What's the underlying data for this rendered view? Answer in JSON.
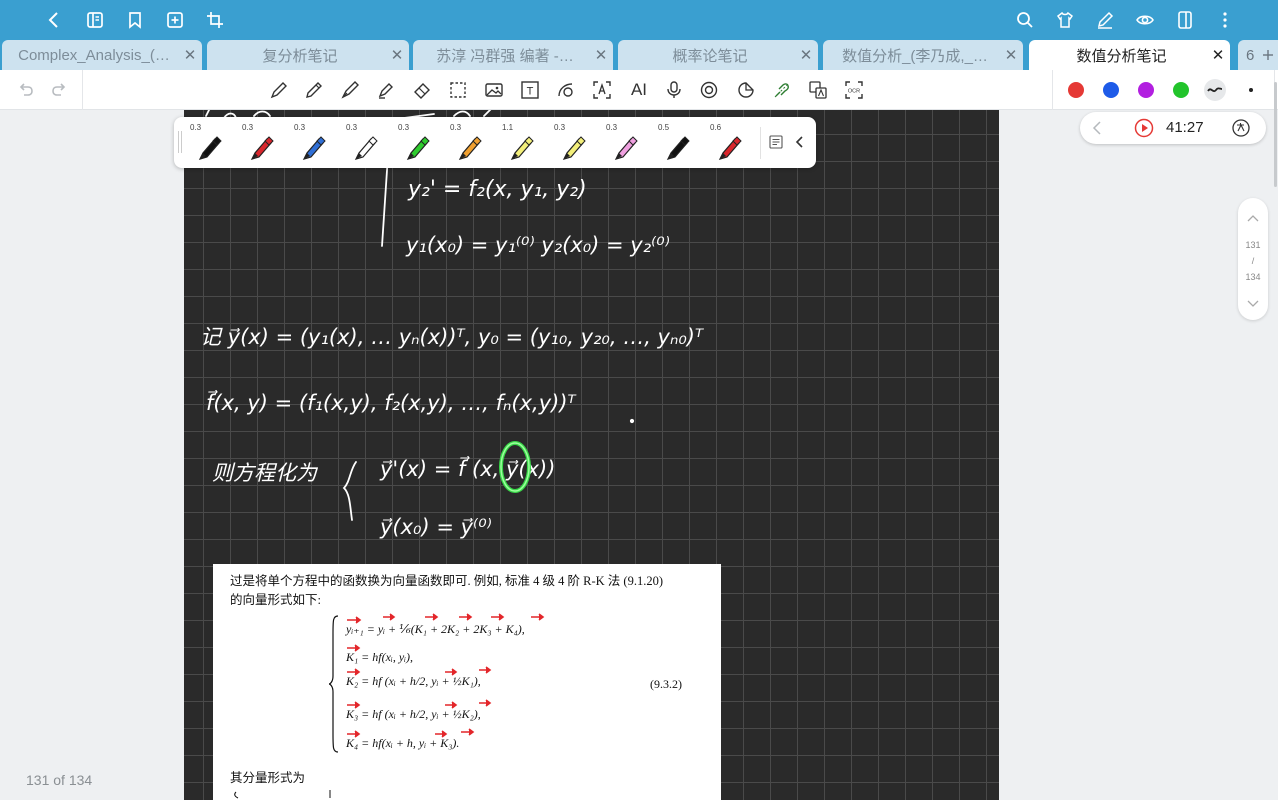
{
  "tabs": [
    {
      "label": "Complex_Analysis_(…",
      "close": "✕"
    },
    {
      "label": "复分析笔记",
      "close": "✕"
    },
    {
      "label": "苏淳 冯群强 编著 -…",
      "close": "✕"
    },
    {
      "label": "概率论笔记",
      "close": "✕"
    },
    {
      "label": "数值分析_(李乃成,_…",
      "close": "✕"
    },
    {
      "label": "数值分析笔记",
      "close": "✕",
      "active": true
    }
  ],
  "tab_more": {
    "count": "6",
    "icon": "plus-icon"
  },
  "toolbar": {
    "text_tool_label": "T",
    "ai_label": "AI",
    "ocr_label": "OCR",
    "colors": [
      "#e53935",
      "#1e5be8",
      "#b21fe0",
      "#22c42b"
    ]
  },
  "pens": [
    {
      "size": "0.3",
      "color": "#111111"
    },
    {
      "size": "0.3",
      "color": "#d9262c"
    },
    {
      "size": "0.3",
      "color": "#2f6fd6"
    },
    {
      "size": "0.3",
      "color": "#ffffff"
    },
    {
      "size": "0.3",
      "color": "#2ecc2e"
    },
    {
      "size": "0.3",
      "color": "#f0a030"
    },
    {
      "size": "1.1",
      "color": "#f3ef7a"
    },
    {
      "size": "0.3",
      "color": "#f3ef7a"
    },
    {
      "size": "0.3",
      "color": "#f0a0e0"
    },
    {
      "size": "0.5",
      "color": "#111111"
    },
    {
      "size": "0.6",
      "color": "#d9262c"
    }
  ],
  "recording": {
    "time": "41:27"
  },
  "page_nav": {
    "current": "131",
    "sep": "/",
    "total": "134"
  },
  "page_count": "131 of 134",
  "paper": {
    "line1": "过是将单个方程中的函数换为向量函数即可. 例如, 标准 4 级 4 阶 R-K 法 (9.1.20)",
    "line2": "的向量形式如下:",
    "eq1": "yᵢ₊₁ = yᵢ + ⅙(K₁ + 2K₂ + 2K₃ + K₄),",
    "eq2": "K₁ = hf(xᵢ, yᵢ),",
    "eq3": "K₂ = hf (xᵢ + h/2, yᵢ + ½K₁),",
    "eq4": "K₃ = hf (xᵢ + h/2, yᵢ + ½K₂),",
    "eq5": "K₄ = hf(xᵢ + h, yᵢ + K₃).",
    "eq_no": "(9.3.2)",
    "line3": "其分量形式为"
  },
  "handwriting": {
    "line_a": "y₂' = f₂(x, y₁, y₂)",
    "line_b": "y₁(x₀) = y₁⁽⁰⁾    y₂(x₀) = y₂⁽⁰⁾",
    "line_c": "记 y⃗(x) = (y₁(x), … yₙ(x))ᵀ,   y₀ = (y₁₀, y₂₀, …, yₙ₀)ᵀ",
    "line_d": "f⃗(x, y) = (f₁(x,y), f₂(x,y), …, fₙ(x,y))ᵀ",
    "line_e": "则方程化为",
    "line_f": "y⃗'(x) = f⃗ (x, y⃗(x))",
    "line_g": "y⃗(x₀) = y⃗⁽⁰⁾"
  }
}
